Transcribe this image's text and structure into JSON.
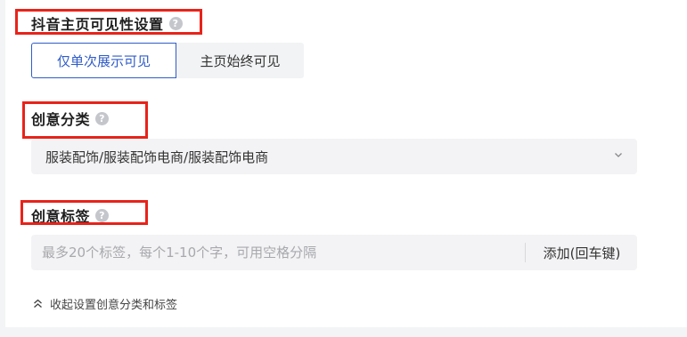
{
  "visibility": {
    "title": "抖音主页可见性设置",
    "help": "?",
    "options": [
      {
        "label": "仅单次展示可见",
        "selected": true
      },
      {
        "label": "主页始终可见",
        "selected": false
      }
    ]
  },
  "category": {
    "title": "创意分类",
    "help": "?",
    "value": "服装配饰/服装配饰电商/服装配饰电商",
    "icon": "chevron-down-icon"
  },
  "tags": {
    "title": "创意标签",
    "help": "?",
    "placeholder": "最多20个标签，每个1-10个字，可用空格分隔",
    "add_label": "添加(回车键)"
  },
  "collapse": {
    "label": "收起设置创意分类和标签",
    "icon": "double-chevron-up-icon"
  },
  "colors": {
    "accent": "#2f5cc8",
    "highlight_box": "#e8231a",
    "field_bg": "#f3f3f5"
  }
}
